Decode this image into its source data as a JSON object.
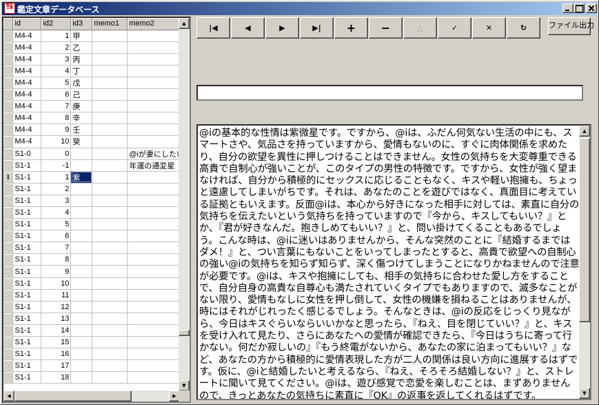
{
  "window": {
    "title": "鑑定文章データベース",
    "app_icon_text": "鑑定文章"
  },
  "grid": {
    "columns": [
      "id",
      "id2",
      "id3",
      "memo1",
      "memo2"
    ],
    "rows": [
      {
        "id": "M4-4",
        "id2": "1",
        "id3": "甲",
        "memo1": "",
        "memo2": ""
      },
      {
        "id": "M4-4",
        "id2": "2",
        "id3": "乙",
        "memo1": "",
        "memo2": ""
      },
      {
        "id": "M4-4",
        "id2": "3",
        "id3": "丙",
        "memo1": "",
        "memo2": ""
      },
      {
        "id": "M4-4",
        "id2": "4",
        "id3": "丁",
        "memo1": "",
        "memo2": ""
      },
      {
        "id": "M4-4",
        "id2": "5",
        "id3": "戊",
        "memo1": "",
        "memo2": ""
      },
      {
        "id": "M4-4",
        "id2": "6",
        "id3": "己",
        "memo1": "",
        "memo2": ""
      },
      {
        "id": "M4-4",
        "id2": "7",
        "id3": "庚",
        "memo1": "",
        "memo2": ""
      },
      {
        "id": "M4-4",
        "id2": "8",
        "id3": "辛",
        "memo1": "",
        "memo2": ""
      },
      {
        "id": "M4-4",
        "id2": "9",
        "id3": "壬",
        "memo1": "",
        "memo2": ""
      },
      {
        "id": "M4-4",
        "id2": "10",
        "id3": "癸",
        "memo1": "",
        "memo2": ""
      },
      {
        "id": "S1-0",
        "id2": "0",
        "id3": "",
        "memo1": "",
        "memo2": "@iが妻にしたい"
      },
      {
        "id": "S1-1",
        "id2": "-1",
        "id3": "",
        "memo1": "",
        "memo2": "年運の通変星"
      },
      {
        "id": "S1-1",
        "id2": "1",
        "id3": "紫",
        "memo1": "",
        "memo2": ""
      },
      {
        "id": "S1-1",
        "id2": "2",
        "id3": "",
        "memo1": "",
        "memo2": ""
      },
      {
        "id": "S1-1",
        "id2": "3",
        "id3": "",
        "memo1": "",
        "memo2": ""
      },
      {
        "id": "S1-1",
        "id2": "4",
        "id3": "",
        "memo1": "",
        "memo2": ""
      },
      {
        "id": "S1-1",
        "id2": "5",
        "id3": "",
        "memo1": "",
        "memo2": ""
      },
      {
        "id": "S1-1",
        "id2": "6",
        "id3": "",
        "memo1": "",
        "memo2": ""
      },
      {
        "id": "S1-1",
        "id2": "7",
        "id3": "",
        "memo1": "",
        "memo2": ""
      },
      {
        "id": "S1-1",
        "id2": "8",
        "id3": "",
        "memo1": "",
        "memo2": ""
      },
      {
        "id": "S1-1",
        "id2": "9",
        "id3": "",
        "memo1": "",
        "memo2": ""
      },
      {
        "id": "S1-1",
        "id2": "10",
        "id3": "",
        "memo1": "",
        "memo2": ""
      },
      {
        "id": "S1-1",
        "id2": "11",
        "id3": "",
        "memo1": "",
        "memo2": ""
      },
      {
        "id": "S1-1",
        "id2": "12",
        "id3": "",
        "memo1": "",
        "memo2": ""
      },
      {
        "id": "S1-1",
        "id2": "13",
        "id3": "",
        "memo1": "",
        "memo2": ""
      },
      {
        "id": "S1-1",
        "id2": "14",
        "id3": "",
        "memo1": "",
        "memo2": ""
      },
      {
        "id": "S1-1",
        "id2": "15",
        "id3": "",
        "memo1": "",
        "memo2": ""
      },
      {
        "id": "S1-1",
        "id2": "16",
        "id3": "",
        "memo1": "",
        "memo2": ""
      },
      {
        "id": "S1-1",
        "id2": "17",
        "id3": "",
        "memo1": "",
        "memo2": ""
      },
      {
        "id": "S1-1",
        "id2": "18",
        "id3": "",
        "memo1": "",
        "memo2": ""
      }
    ],
    "selected_row": 12,
    "selected_col": "id3",
    "cursor_indicator": "I"
  },
  "navigator": {
    "buttons": [
      {
        "name": "first-record",
        "glyph": "|◀",
        "disabled": false
      },
      {
        "name": "prior-record",
        "glyph": "◀",
        "disabled": false
      },
      {
        "name": "next-record",
        "glyph": "▶",
        "disabled": false
      },
      {
        "name": "last-record",
        "glyph": "▶|",
        "disabled": false
      },
      {
        "name": "insert-record",
        "glyph": "+",
        "disabled": false
      },
      {
        "name": "delete-record",
        "glyph": "−",
        "disabled": false
      },
      {
        "name": "edit-record",
        "glyph": "△",
        "disabled": true
      },
      {
        "name": "post-record",
        "glyph": "✓",
        "disabled": false
      },
      {
        "name": "cancel-edit",
        "glyph": "✕",
        "disabled": false
      },
      {
        "name": "refresh-data",
        "glyph": "↻",
        "disabled": false
      }
    ],
    "export_label": "ファイル出力"
  },
  "edit_field": {
    "value": ""
  },
  "memo": {
    "text": "@iの基本的な性情は紫微星です。ですから、@iは、ふだん何気ない生活の中にも、スマートさや、気品さを持っていますから、愛情もないのに、すぐに肉体関係を求めたり、自分の欲望を異性に押しつけることはできません。女性の気持ちを大変尊重できる高貴で自制心が強いことが、このタイプの男性の特徴です。ですから、女性が強く望まなければ、自分から積極的にセックスに応じることもなく、キスや軽い抱擁も、ちょっと遠慮してしまいがちです。それは、あなたのことを遊びではなく、真面目に考えている証拠ともいえます。反面@iは、本心から好きになった相手に対しては、素直に自分の気持ちを伝えたいという気持ちを持っていますので『今から、キスしてもいい？』とか、『君が好きなんだ。抱きしめてもいい？』と、問い掛けてくることもあるでしょう。こんな時は、@iに迷いはありませんから、そんな突然のことに『結婚するまではダメ！』と、つい言葉にもないことをいってしまったとすると、高貴で欲望への自制心の強い@iの気持ちを知らず知らず、深く傷つけてしまうことになりかねませんので注意が必要です。@iは、キスや抱擁にしても、相手の気持ちに合わせた愛し方をすることで、自分自身の高貴な自尊心も満たされていくタイプでもありますので、滅多なことがない限り、愛情もなしに女性を押し倒して、女性の機嫌を損ねることはありませんが、時にはそれがじれったく感じるでしょう。そんなときは、@iの反応をじっくり見ながら、今日はキスぐらいならいいかなと思ったら、『ねえ、目を閉じていい？』と、キスを受け入れて見たり、さらにあなたへの愛情が確認できたら、『今日はうちに寄って行かない。何だか寂しいの』『もう終電がないから、あなたの家に泊まってもいい？』など、あなたの方から積極的に愛情表現した方が二人の関係は良い方向に進展するはずです。仮に、@iと結婚したいと考えるなら、『ねえ、そろそろ結婚しない？』と、ストレートに聞いて見てください。@iは、遊び感覚で恋愛を楽しむことは、まずありませんので、きっとあなたの気持ちに素直に『OK』の返事を返してくれるはずです。"
  }
}
